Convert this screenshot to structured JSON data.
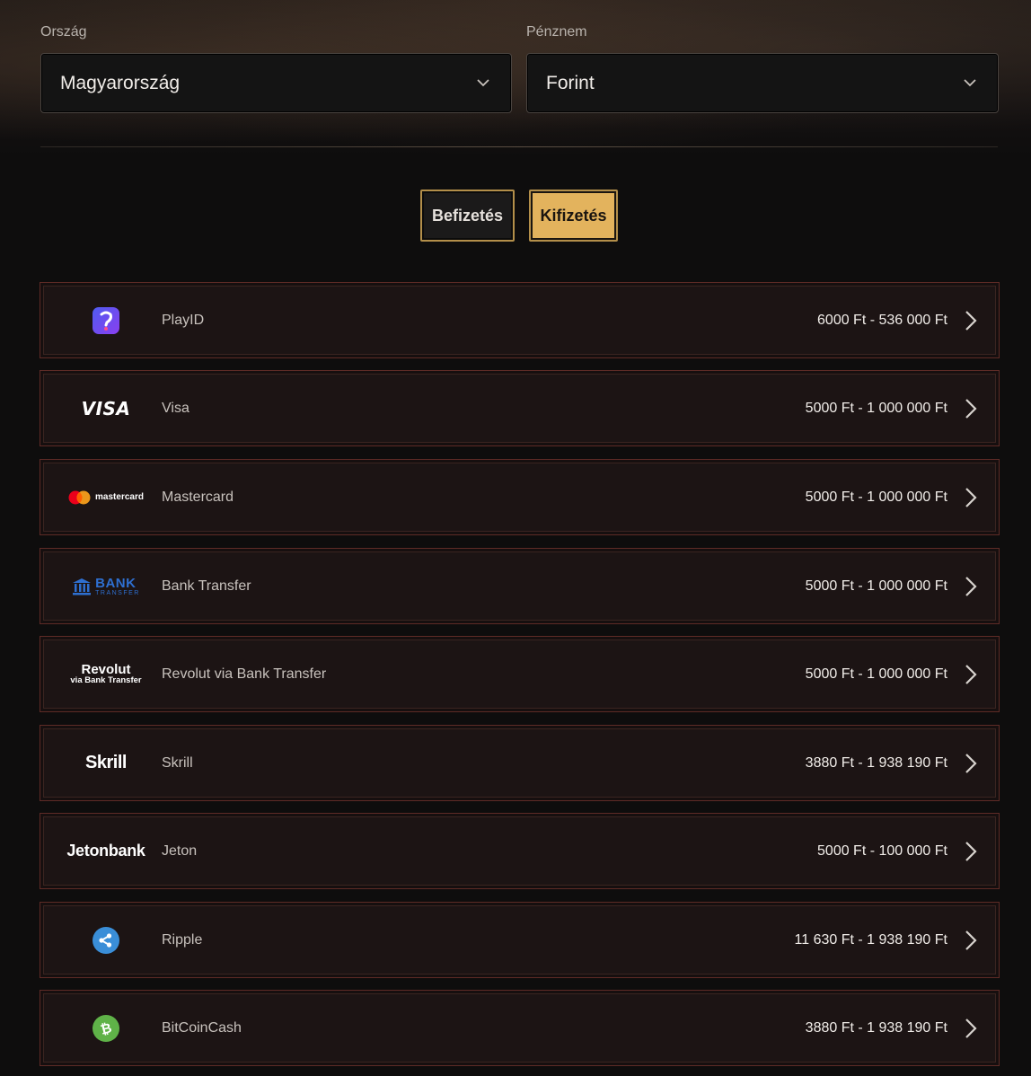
{
  "filters": {
    "country": {
      "label": "Ország",
      "value": "Magyarország"
    },
    "currency": {
      "label": "Pénznem",
      "value": "Forint"
    }
  },
  "tabs": {
    "deposit": "Befizetés",
    "withdraw": "Kifizetés",
    "active": "withdraw"
  },
  "methods": [
    {
      "name": "PlayID",
      "range": "6000 Ft - 536 000 Ft",
      "logo": "playid-icon"
    },
    {
      "name": "Visa",
      "range": "5000 Ft - 1 000 000 Ft",
      "logo": "visa-logo",
      "logo_text": "VISA"
    },
    {
      "name": "Mastercard",
      "range": "5000 Ft - 1 000 000 Ft",
      "logo": "mastercard-logo",
      "logo_text": "mastercard"
    },
    {
      "name": "Bank Transfer",
      "range": "5000 Ft - 1 000 000 Ft",
      "logo": "bank-transfer-logo",
      "logo_text": "BANK",
      "logo_subtext": "TRANSFER"
    },
    {
      "name": "Revolut via Bank Transfer",
      "range": "5000 Ft - 1 000 000 Ft",
      "logo": "revolut-logo",
      "logo_text": "Revolut",
      "logo_subtext": "via Bank Transfer"
    },
    {
      "name": "Skrill",
      "range": "3880 Ft - 1 938 190 Ft",
      "logo": "skrill-logo",
      "logo_text": "Skrill"
    },
    {
      "name": "Jeton",
      "range": "5000 Ft - 100 000 Ft",
      "logo": "jetonbank-logo",
      "logo_text": "Jetonbank"
    },
    {
      "name": "Ripple",
      "range": "11 630 Ft - 1 938 190 Ft",
      "logo": "ripple-icon"
    },
    {
      "name": "BitCoinCash",
      "range": "3880 Ft - 1 938 190 Ft",
      "logo": "bitcoincash-icon"
    }
  ],
  "colors": {
    "accent": "#e3b35d",
    "row_border": "#5e2b26",
    "background": "#0e0d0d"
  }
}
